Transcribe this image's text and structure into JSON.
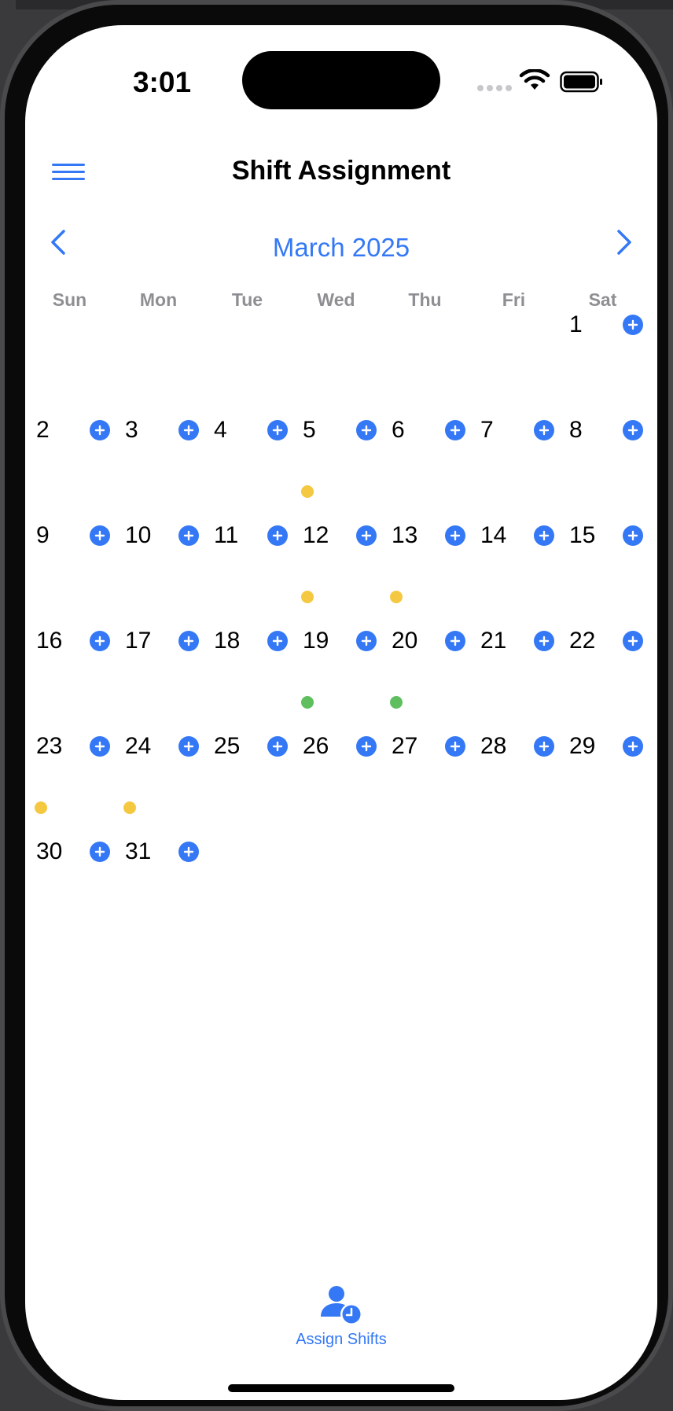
{
  "status_bar": {
    "time": "3:01"
  },
  "header": {
    "title": "Shift Assignment"
  },
  "calendar": {
    "month_label": "March 2025",
    "weekdays": [
      "Sun",
      "Mon",
      "Tue",
      "Wed",
      "Thu",
      "Fri",
      "Sat"
    ],
    "first_weekday_index": 6,
    "days_in_month": 31,
    "shift_dots": [
      {
        "day": 5,
        "color": "#f5c842"
      },
      {
        "day": 12,
        "color": "#f5c842"
      },
      {
        "day": 13,
        "color": "#f5c842"
      },
      {
        "day": 19,
        "color": "#5fbf5f"
      },
      {
        "day": 20,
        "color": "#5fbf5f"
      },
      {
        "day": 23,
        "color": "#f5c842"
      },
      {
        "day": 24,
        "color": "#f5c842"
      }
    ]
  },
  "tab_bar": {
    "assign_shifts_label": "Assign Shifts"
  },
  "colors": {
    "accent": "#3478f6",
    "pending": "#f5c842",
    "assigned": "#5fbf5f"
  },
  "icons": {
    "menu": "hamburger-icon",
    "prev": "chevron-left-icon",
    "next": "chevron-right-icon",
    "add": "plus-circle-icon",
    "tab": "person-clock-icon"
  }
}
